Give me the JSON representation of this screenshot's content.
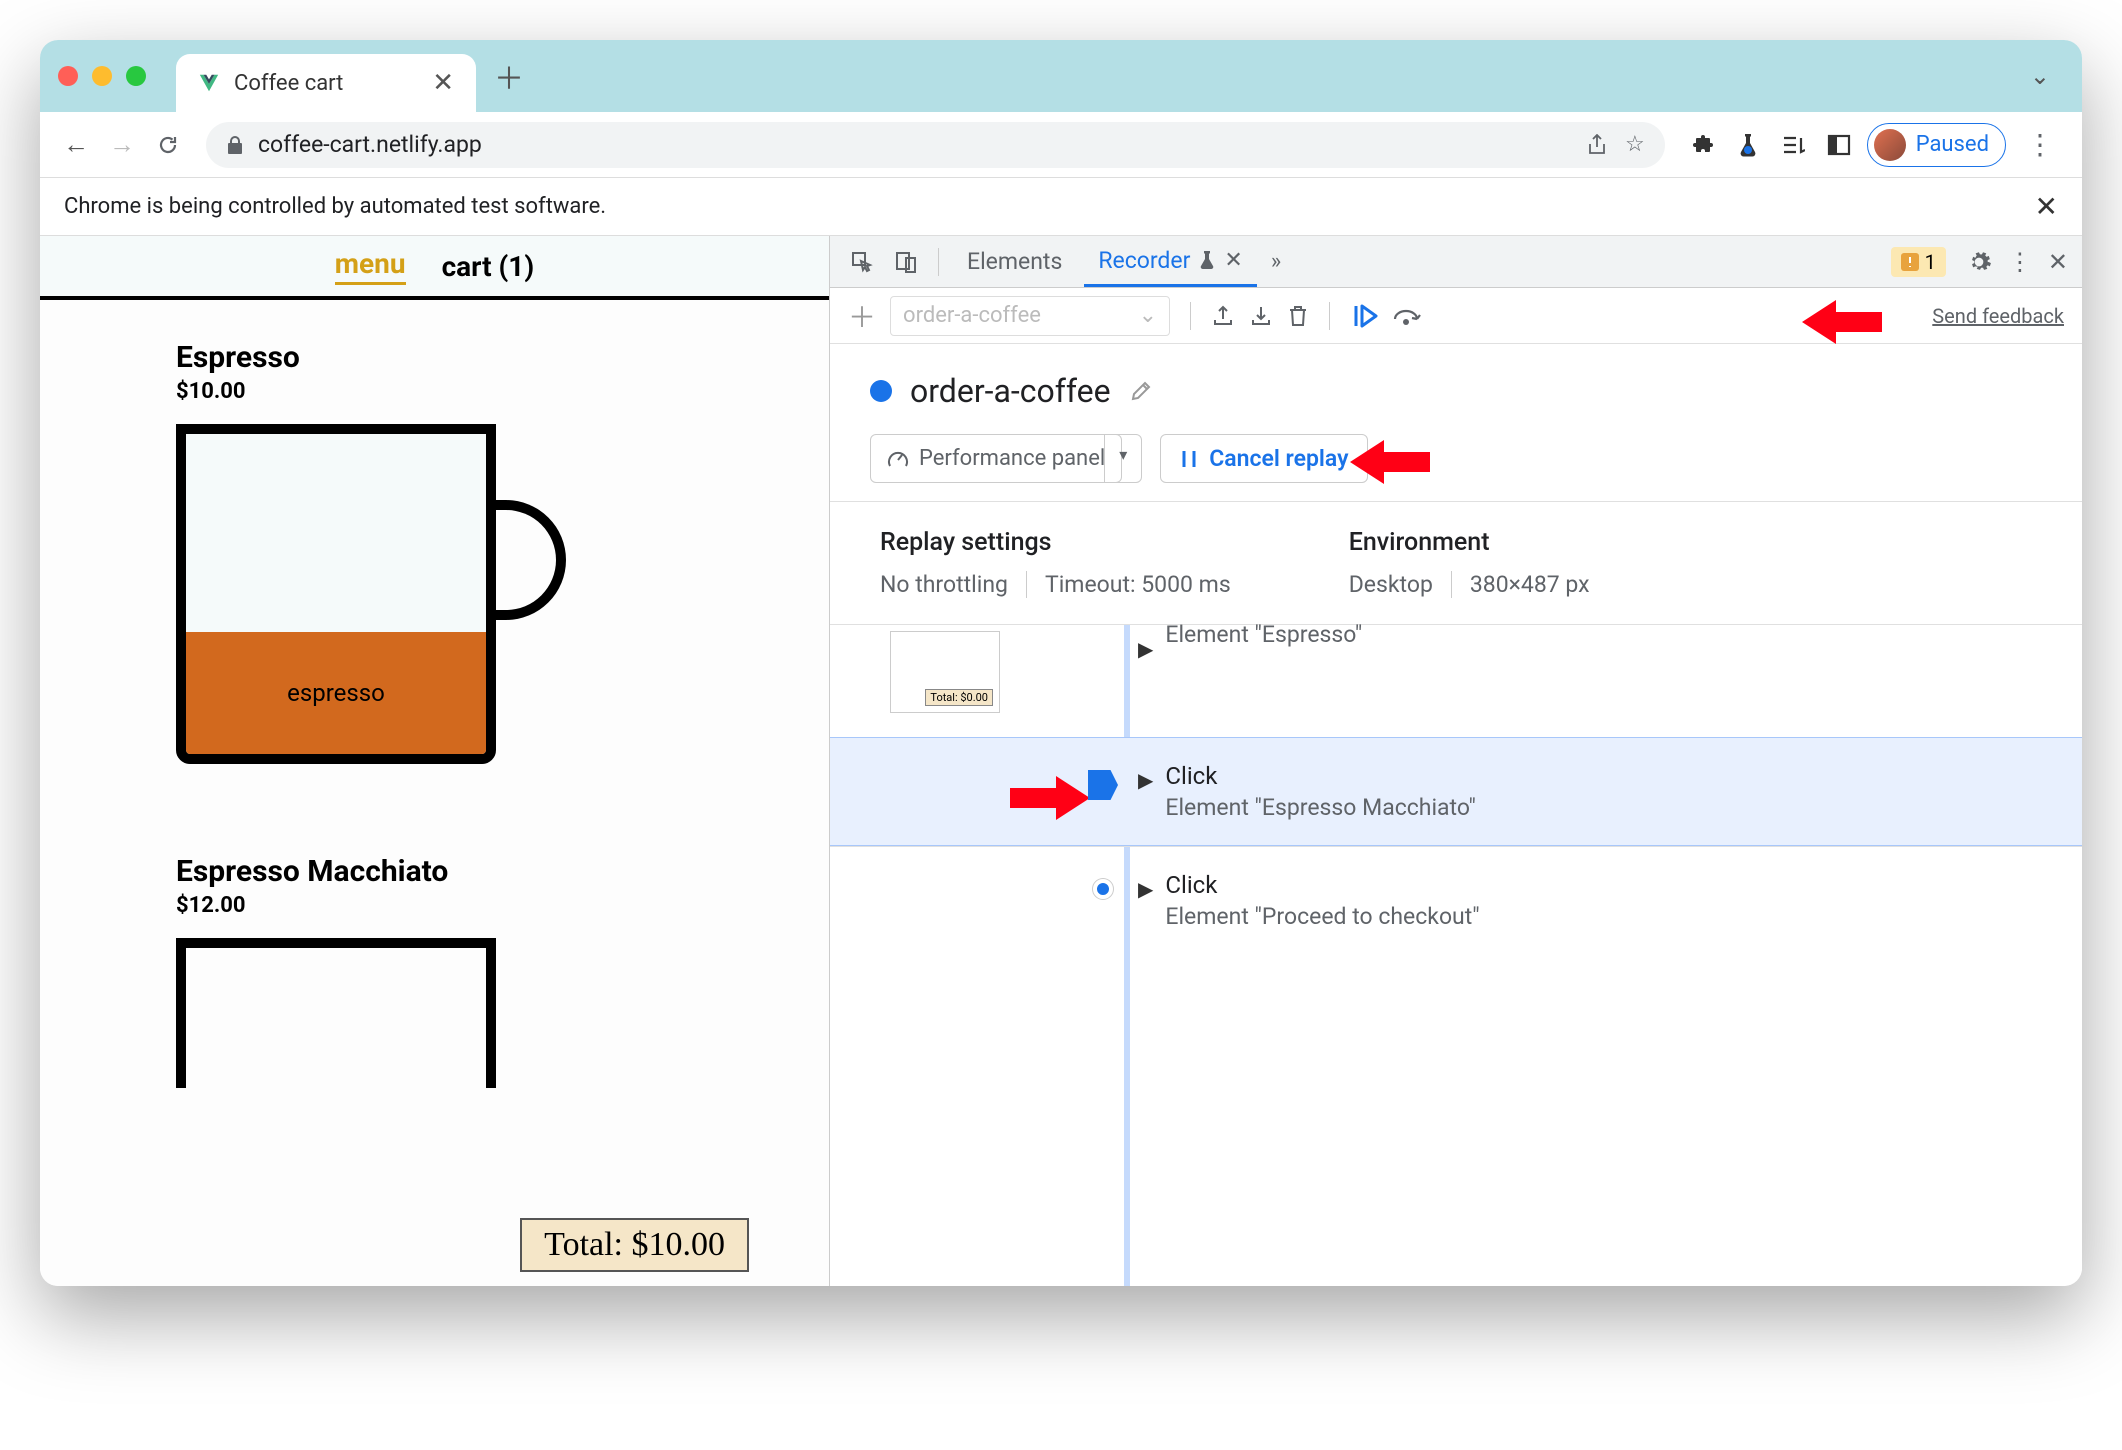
{
  "browser": {
    "tab_title": "Coffee cart",
    "url": "coffee-cart.netlify.app",
    "paused_label": "Paused",
    "infobar_text": "Chrome is being controlled by automated test software."
  },
  "page": {
    "nav_menu": "menu",
    "nav_cart": "cart (1)",
    "item1_title": "Espresso",
    "item1_price": "$10.00",
    "item1_fill": "espresso",
    "item2_title": "Espresso Macchiato",
    "item2_price": "$12.00",
    "total_chip": "Total: $10.00"
  },
  "devtools": {
    "tab_elements": "Elements",
    "tab_recorder": "Recorder",
    "issues_count": "1",
    "recorder": {
      "dropdown_placeholder": "order-a-coffee",
      "feedback": "Send feedback",
      "recording_name": "order-a-coffee",
      "perf_button": "Performance panel",
      "cancel_button": "Cancel replay",
      "settings": {
        "replay_title": "Replay settings",
        "replay_throttling": "No throttling",
        "replay_timeout": "Timeout: 5000 ms",
        "env_title": "Environment",
        "env_device": "Desktop",
        "env_viewport": "380×487 px"
      },
      "steps": {
        "s0_sub": "Element \"Espresso\"",
        "s0_thumb": "Total: $0.00",
        "s1_title": "Click",
        "s1_sub": "Element \"Espresso Macchiato\"",
        "s2_title": "Click",
        "s2_sub": "Element \"Proceed to checkout\""
      }
    }
  }
}
